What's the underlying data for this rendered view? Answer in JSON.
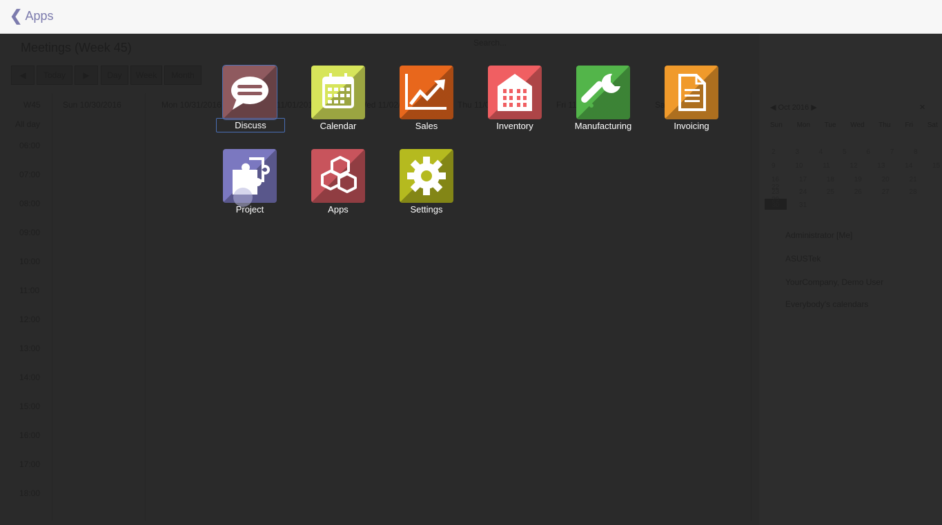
{
  "topbar": {
    "back_label": "Apps"
  },
  "background": {
    "title": "Meetings (Week 45)",
    "search_placeholder": "Search...",
    "view_buttons": [
      "Today",
      "Day",
      "Week",
      "Month"
    ],
    "week_label": "W45",
    "allday_label": "All day",
    "day_headers": [
      "Sun 10/30/2016",
      "Mon 10/31/2016",
      "Tue 11/01/2016",
      "Wed 11/02/2016",
      "Thu 11/03/2016",
      "Fri 11/04/2016",
      "Sat 11/05/2016"
    ],
    "hours": [
      "06:00",
      "07:00",
      "08:00",
      "09:00",
      "10:00",
      "11:00",
      "12:00",
      "13:00",
      "14:00",
      "15:00",
      "16:00",
      "17:00",
      "18:00"
    ],
    "mini_calendar": {
      "month_label": "Oct 2016",
      "weekdays": [
        "Sun",
        "Mon",
        "Tue",
        "Wed",
        "Thu",
        "Fri",
        "Sat"
      ],
      "weeks": [
        "2 3 4 5 6 7 8",
        "9 10 11 12 13 14 15",
        "16 17 18 19 20 21 22",
        "23 24 25 26 27 28 29",
        "30 31"
      ]
    },
    "attendees": [
      "Administrator [Me]",
      "ASUSTek",
      "YourCompany, Demo User",
      "Everybody's calendars"
    ]
  },
  "apps": [
    {
      "key": "discuss",
      "label": "Discuss",
      "color": "#8f5a5f",
      "icon": "chat-icon",
      "focused": true
    },
    {
      "key": "calendar",
      "label": "Calendar",
      "color": "#d7e55a",
      "icon": "calendar-icon"
    },
    {
      "key": "sales",
      "label": "Sales",
      "color": "#e8671c",
      "icon": "trend-chart-icon"
    },
    {
      "key": "inventory",
      "label": "Inventory",
      "color": "#f05f62",
      "icon": "warehouse-icon"
    },
    {
      "key": "manufacturing",
      "label": "Manufacturing",
      "color": "#53b54a",
      "icon": "wrench-icon"
    },
    {
      "key": "invoicing",
      "label": "Invoicing",
      "color": "#f09a2b",
      "icon": "document-icon"
    },
    {
      "key": "project",
      "label": "Project",
      "color": "#7b78c0",
      "icon": "puzzle-icon"
    },
    {
      "key": "apps",
      "label": "Apps",
      "color": "#c8545c",
      "icon": "cubes-icon"
    },
    {
      "key": "settings",
      "label": "Settings",
      "color": "#b5ba1f",
      "icon": "gear-icon"
    }
  ]
}
